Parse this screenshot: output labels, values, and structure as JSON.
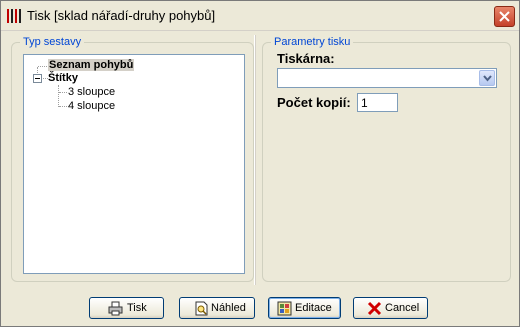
{
  "window": {
    "title": "Tisk [sklad nářadí-druhy pohybů]"
  },
  "left_group": {
    "legend": "Typ sestavy",
    "tree": {
      "items": [
        {
          "label": "Seznam pohybů",
          "selected": true,
          "bold": true
        },
        {
          "label": "Štítky",
          "bold": true,
          "expanded": true,
          "children": [
            {
              "label": "3 sloupce"
            },
            {
              "label": "4 sloupce"
            }
          ]
        }
      ]
    }
  },
  "right_group": {
    "legend": "Parametry tisku",
    "printer_label": "Tiskárna:",
    "printer_value": "",
    "copies_label": "Počet kopií:",
    "copies_value": "1"
  },
  "buttons": {
    "print": "Tisk",
    "preview": "Náhled",
    "edit": "Editace",
    "cancel": "Cancel"
  },
  "icons": {
    "app": "report-icon",
    "close": "close-icon",
    "printer": "printer-icon",
    "preview": "preview-icon",
    "edit": "edit-icon",
    "cancel": "cancel-icon"
  }
}
